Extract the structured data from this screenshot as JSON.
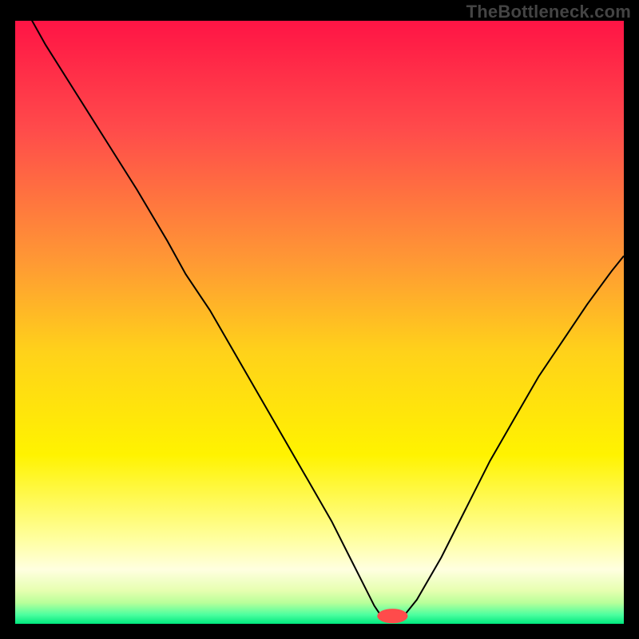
{
  "watermark": "TheBottleneck.com",
  "chart_data": {
    "type": "line",
    "title": "",
    "xlabel": "",
    "ylabel": "",
    "xlim": [
      0,
      100
    ],
    "ylim": [
      0,
      100
    ],
    "grid": false,
    "background_gradient": {
      "direction": "vertical",
      "stops": [
        {
          "offset": 0.0,
          "color": "#ff1445"
        },
        {
          "offset": 0.18,
          "color": "#ff4b4b"
        },
        {
          "offset": 0.4,
          "color": "#ff9934"
        },
        {
          "offset": 0.55,
          "color": "#ffd21a"
        },
        {
          "offset": 0.72,
          "color": "#fff300"
        },
        {
          "offset": 0.86,
          "color": "#ffffa0"
        },
        {
          "offset": 0.91,
          "color": "#ffffe0"
        },
        {
          "offset": 0.945,
          "color": "#e6ffb0"
        },
        {
          "offset": 0.965,
          "color": "#b9ff9a"
        },
        {
          "offset": 0.985,
          "color": "#4cff9f"
        },
        {
          "offset": 1.0,
          "color": "#00e87e"
        }
      ]
    },
    "series": [
      {
        "name": "bottleneck-curve",
        "color": "#000000",
        "stroke_width": 2,
        "x": [
          0,
          5,
          10,
          15,
          20,
          25,
          28,
          32,
          36,
          40,
          44,
          48,
          52,
          55,
          57,
          59,
          60,
          62,
          64,
          66,
          70,
          74,
          78,
          82,
          86,
          90,
          94,
          98,
          100
        ],
        "y": [
          105,
          96,
          88,
          80,
          72,
          63.5,
          58,
          52,
          45,
          38,
          31,
          24,
          17,
          11,
          7,
          3,
          1.5,
          1.2,
          1.5,
          4,
          11,
          19,
          27,
          34,
          41,
          47,
          53,
          58.5,
          61
        ]
      }
    ],
    "flat_segment": {
      "x_start": 58,
      "x_end": 64,
      "y": 1.3
    },
    "marker": {
      "x": 62,
      "y": 1.3,
      "rx": 2.5,
      "ry": 1.2,
      "fill": "#ff4b4b"
    }
  }
}
